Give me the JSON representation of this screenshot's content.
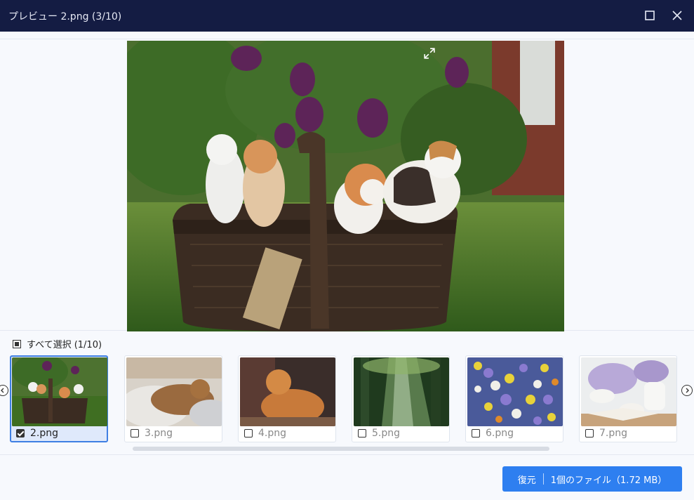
{
  "window": {
    "title": "プレビュー 2.png (3/10)"
  },
  "select_all": {
    "label": "すべて選択 (1/10)"
  },
  "thumbnails": [
    {
      "name": "2.png",
      "checked": true
    },
    {
      "name": "3.png",
      "checked": false
    },
    {
      "name": "4.png",
      "checked": false
    },
    {
      "name": "5.png",
      "checked": false
    },
    {
      "name": "6.png",
      "checked": false
    },
    {
      "name": "7.png",
      "checked": false
    }
  ],
  "footer": {
    "restore_label": "復元",
    "restore_detail": "1個のファイル（1.72 MB）"
  },
  "colors": {
    "titlebar": "#141c43",
    "accent": "#2e7ff0",
    "selected_border": "#3f7fe3"
  }
}
